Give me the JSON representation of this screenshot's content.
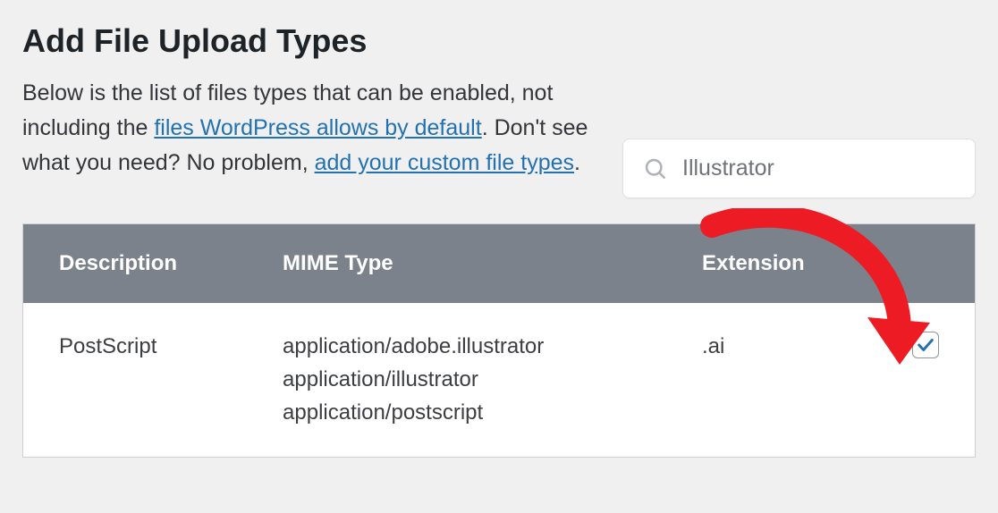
{
  "header": {
    "title": "Add File Upload Types",
    "intro_before_link1": "Below is the list of files types that can be enabled, not including the ",
    "link1": "files WordPress allows by default",
    "intro_middle": ". Don't see what you need? No problem, ",
    "link2": "add your custom file types",
    "intro_end": "."
  },
  "search": {
    "value": "Illustrator"
  },
  "table": {
    "columns": {
      "description": "Description",
      "mime": "MIME Type",
      "extension": "Extension"
    },
    "rows": [
      {
        "description": "PostScript",
        "mime": [
          "application/adobe.illustrator",
          "application/illustrator",
          "application/postscript"
        ],
        "extension": ".ai",
        "checked": true
      }
    ]
  }
}
